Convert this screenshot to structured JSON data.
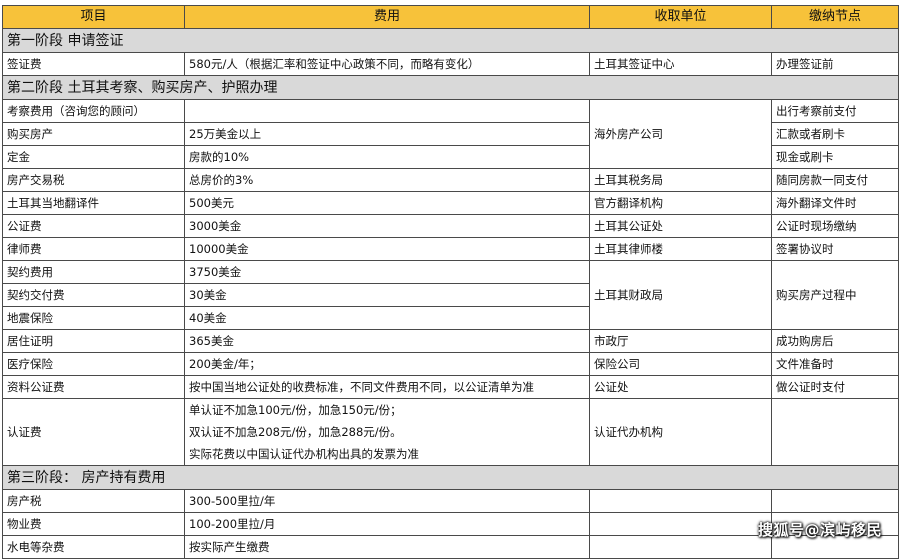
{
  "headers": [
    "项目",
    "费用",
    "收取单位",
    "缴纳节点"
  ],
  "stages": {
    "s1": "第一阶段 申请签证",
    "s2": "第二阶段 土耳其考察、购买房产、护照办理",
    "s3": "第三阶段： 房产持有费用"
  },
  "rows": {
    "visa": {
      "item": "签证费",
      "fee": "580元/人（根据汇率和签证中心政策不同，而略有变化）",
      "payee": "土耳其签证中心",
      "when": "办理签证前"
    },
    "survey": {
      "item": "考察费用（咨询您的顾问）",
      "fee": "",
      "when": "出行考察前支付"
    },
    "buy": {
      "item": "购买房产",
      "fee": "25万美金以上",
      "when": "汇款或者刷卡"
    },
    "deposit": {
      "item": "定金",
      "fee": "房款的10%",
      "when": "现金或刷卡"
    },
    "tax": {
      "item": "房产交易税",
      "fee": "总房价的3%",
      "payee": "土耳其税务局",
      "when": "随同房款一同支付"
    },
    "translate": {
      "item": "土耳其当地翻译件",
      "fee": "500美元",
      "payee": "官方翻译机构",
      "when": "海外翻译文件时"
    },
    "notary": {
      "item": "公证费",
      "fee": "3000美金",
      "payee": "土耳其公证处",
      "when": "公证时现场缴纳"
    },
    "lawyer": {
      "item": "律师费",
      "fee": "10000美金",
      "payee": "土耳其律师楼",
      "when": "签署协议时"
    },
    "contract": {
      "item": "契约费用",
      "fee": "3750美金"
    },
    "contract_delivery": {
      "item": "契约交付费",
      "fee": "30美金"
    },
    "quake": {
      "item": "地震保险",
      "fee": "40美金"
    },
    "residence": {
      "item": "居住证明",
      "fee": "365美金",
      "payee": "市政厅",
      "when": "成功购房后"
    },
    "medical": {
      "item": "医疗保险",
      "fee": "200美金/年；",
      "payee": "保险公司",
      "when": "文件准备时"
    },
    "docs_notary": {
      "item": "资料公证费",
      "fee": "按中国当地公证处的收费标准，不同文件费用不同，以公证清单为准",
      "payee": "公证处",
      "when": "做公证时支付"
    },
    "cert": {
      "item": "认证费",
      "fee_lines": [
        "单认证不加急100元/份，加急150元/份；",
        "双认证不加急208元/份，加急288元/份。",
        "实际花费以中国认证代办机构出具的发票为准"
      ],
      "payee": "认证代办机构",
      "when": ""
    },
    "property_tax": {
      "item": "房产税",
      "fee": "300-500里拉/年",
      "payee": "",
      "when": ""
    },
    "property_mgmt": {
      "item": "物业费",
      "fee": "100-200里拉/月",
      "payee": "",
      "when": ""
    },
    "utilities": {
      "item": "水电等杂费",
      "fee": "按实际产生缴费",
      "payee": "",
      "when": ""
    }
  },
  "merged": {
    "overseas_company": "海外房产公司",
    "finance_bureau": "土耳其财政局",
    "during_purchase": "购买房产过程中"
  },
  "watermark": "搜狐号@滨屿移民",
  "colors": {
    "header_bg": "#f7c23a",
    "stage_bg": "#d9d9d9",
    "border": "#4a4a4a"
  }
}
